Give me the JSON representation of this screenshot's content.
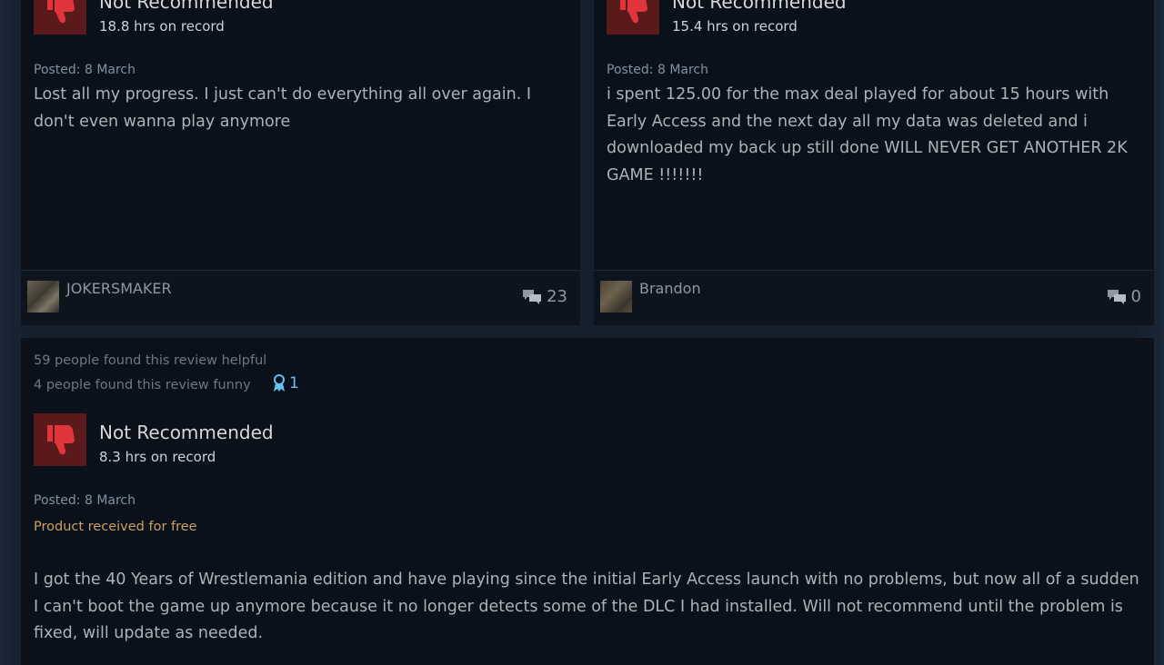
{
  "reviews": [
    {
      "verdict": "Not Recommended",
      "hours": "18.8 hrs on record",
      "posted": "Posted: 8 March",
      "text": "Lost all my progress. I just can't do everything all over again. I don't even wanna play anymore",
      "author": "JOKERSMAKER",
      "comments": "23"
    },
    {
      "verdict": "Not Recommended",
      "hours": "15.4 hrs on record",
      "posted": "Posted: 8 March",
      "text": "i spent 125.00 for the max deal played for about 15 hours with Early Access and the next day all my data was deleted and i downloaded my back up still done WILL NEVER GET ANOTHER 2K GAME !!!!!!!",
      "author": "Brandon",
      "comments": "0"
    },
    {
      "helpful": "59 people found this review helpful",
      "funny": "4 people found this review funny",
      "awards": "1",
      "verdict": "Not Recommended",
      "hours": "8.3 hrs on record",
      "posted": "Posted: 8 March",
      "product_note": "Product received for free",
      "text": "I got the 40 Years of Wrestlemania edition and have playing since the initial Early Access launch with no problems, but now all of a sudden I can't boot the game up anymore because it no longer detects some of the DLC I had installed. Will not recommend until the problem is fixed, will update as needed."
    }
  ],
  "colors": {
    "thumb_bg": "#5a1a1b",
    "thumb_icon": "#e0353b",
    "award": "#66c0f4",
    "free_note": "#c9a06a"
  },
  "icons": {
    "verdict": "thumbs-down-icon",
    "comments": "speech-bubbles-icon",
    "award": "award-ribbon-icon"
  }
}
